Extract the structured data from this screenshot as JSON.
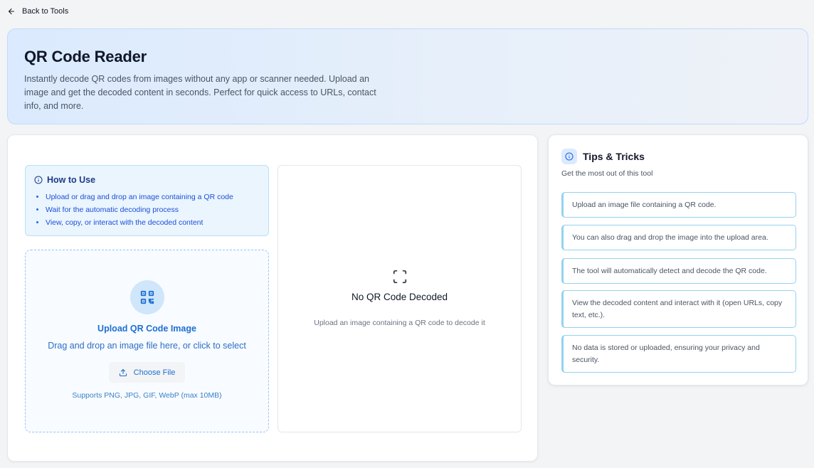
{
  "nav": {
    "back_label": "Back to Tools"
  },
  "hero": {
    "title": "QR Code Reader",
    "description": "Instantly decode QR codes from images without any app or scanner needed. Upload an image and get the decoded content in seconds. Perfect for quick access to URLs, contact info, and more."
  },
  "how_to": {
    "title": "How to Use",
    "steps": [
      "Upload or drag and drop an image containing a QR code",
      "Wait for the automatic decoding process",
      "View, copy, or interact with the decoded content"
    ]
  },
  "upload": {
    "title": "Upload QR Code Image",
    "subtitle": "Drag and drop an image file here, or click to select",
    "button_label": "Choose File",
    "note": "Supports PNG, JPG, GIF, WebP (max 10MB)"
  },
  "result": {
    "title": "No QR Code Decoded",
    "subtitle": "Upload an image containing a QR code to decode it"
  },
  "tips": {
    "title": "Tips & Tricks",
    "subtitle": "Get the most out of this tool",
    "items": [
      "Upload an image file containing a QR code.",
      "You can also drag and drop the image into the upload area.",
      "The tool will automatically detect and decode the QR code.",
      "View the decoded content and interact with it (open URLs, copy text, etc.).",
      "No data is stored or uploaded, ensuring your privacy and security."
    ]
  },
  "colors": {
    "accent": "#1d6fd1",
    "tip_border": "#93d2f0",
    "hero_border": "#bfdbfe"
  }
}
